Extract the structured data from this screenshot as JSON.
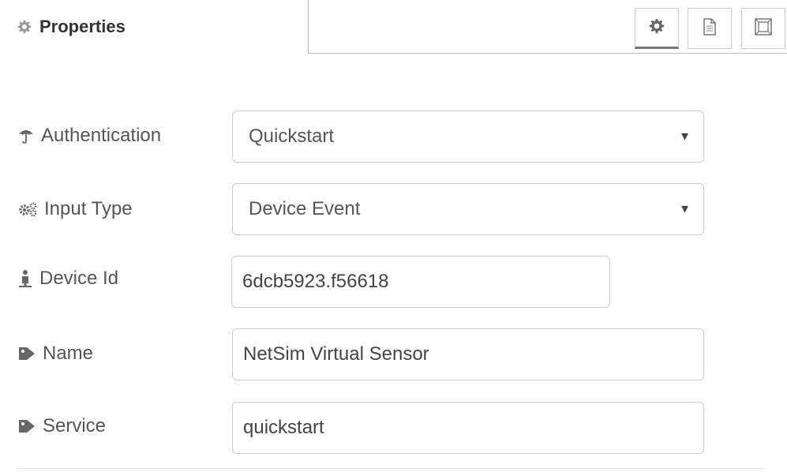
{
  "panel": {
    "title": "Properties",
    "tabs": [
      {
        "icon": "gear-icon",
        "active": true
      },
      {
        "icon": "document-icon",
        "active": false
      },
      {
        "icon": "frame-icon",
        "active": false
      }
    ]
  },
  "form": {
    "authentication": {
      "label": "Authentication",
      "value": "Quickstart",
      "icon": "umbrella-icon"
    },
    "input_type": {
      "label": "Input Type",
      "value": "Device Event",
      "icon": "gears-icon"
    },
    "device_id": {
      "label": "Device Id",
      "value": "6dcb5923.f56618",
      "icon": "person-icon"
    },
    "name": {
      "label": "Name",
      "value": "NetSim Virtual Sensor",
      "icon": "tag-icon"
    },
    "service": {
      "label": "Service",
      "value": "quickstart",
      "icon": "tag-icon"
    }
  },
  "colors": {
    "text": "#555555",
    "border": "#cccccc",
    "icon": "#777777"
  }
}
